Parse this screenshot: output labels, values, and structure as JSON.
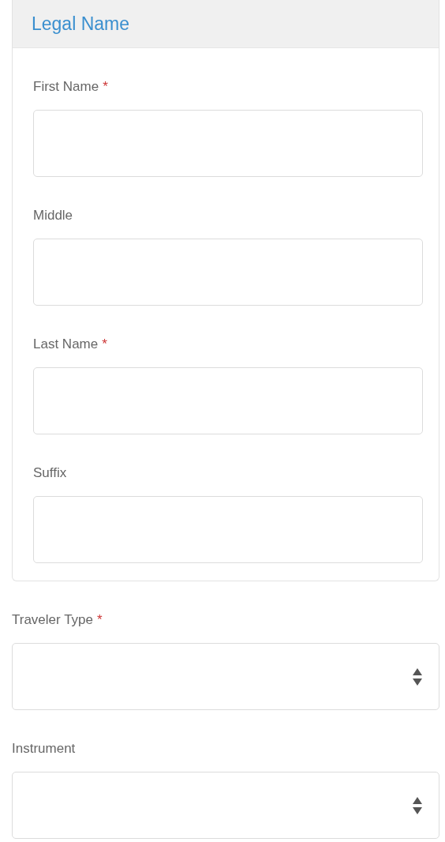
{
  "section": {
    "title": "Legal Name",
    "fields": [
      {
        "label": "First Name",
        "mark": "*"
      },
      {
        "label": "Middle"
      },
      {
        "label": "Last Name",
        "mark": "*"
      },
      {
        "label": "Suffix"
      }
    ]
  },
  "fields": [
    {
      "label": "Traveler Type",
      "mark": "*",
      "kind": "select"
    },
    {
      "label": "Instrument",
      "kind": "select"
    }
  ]
}
